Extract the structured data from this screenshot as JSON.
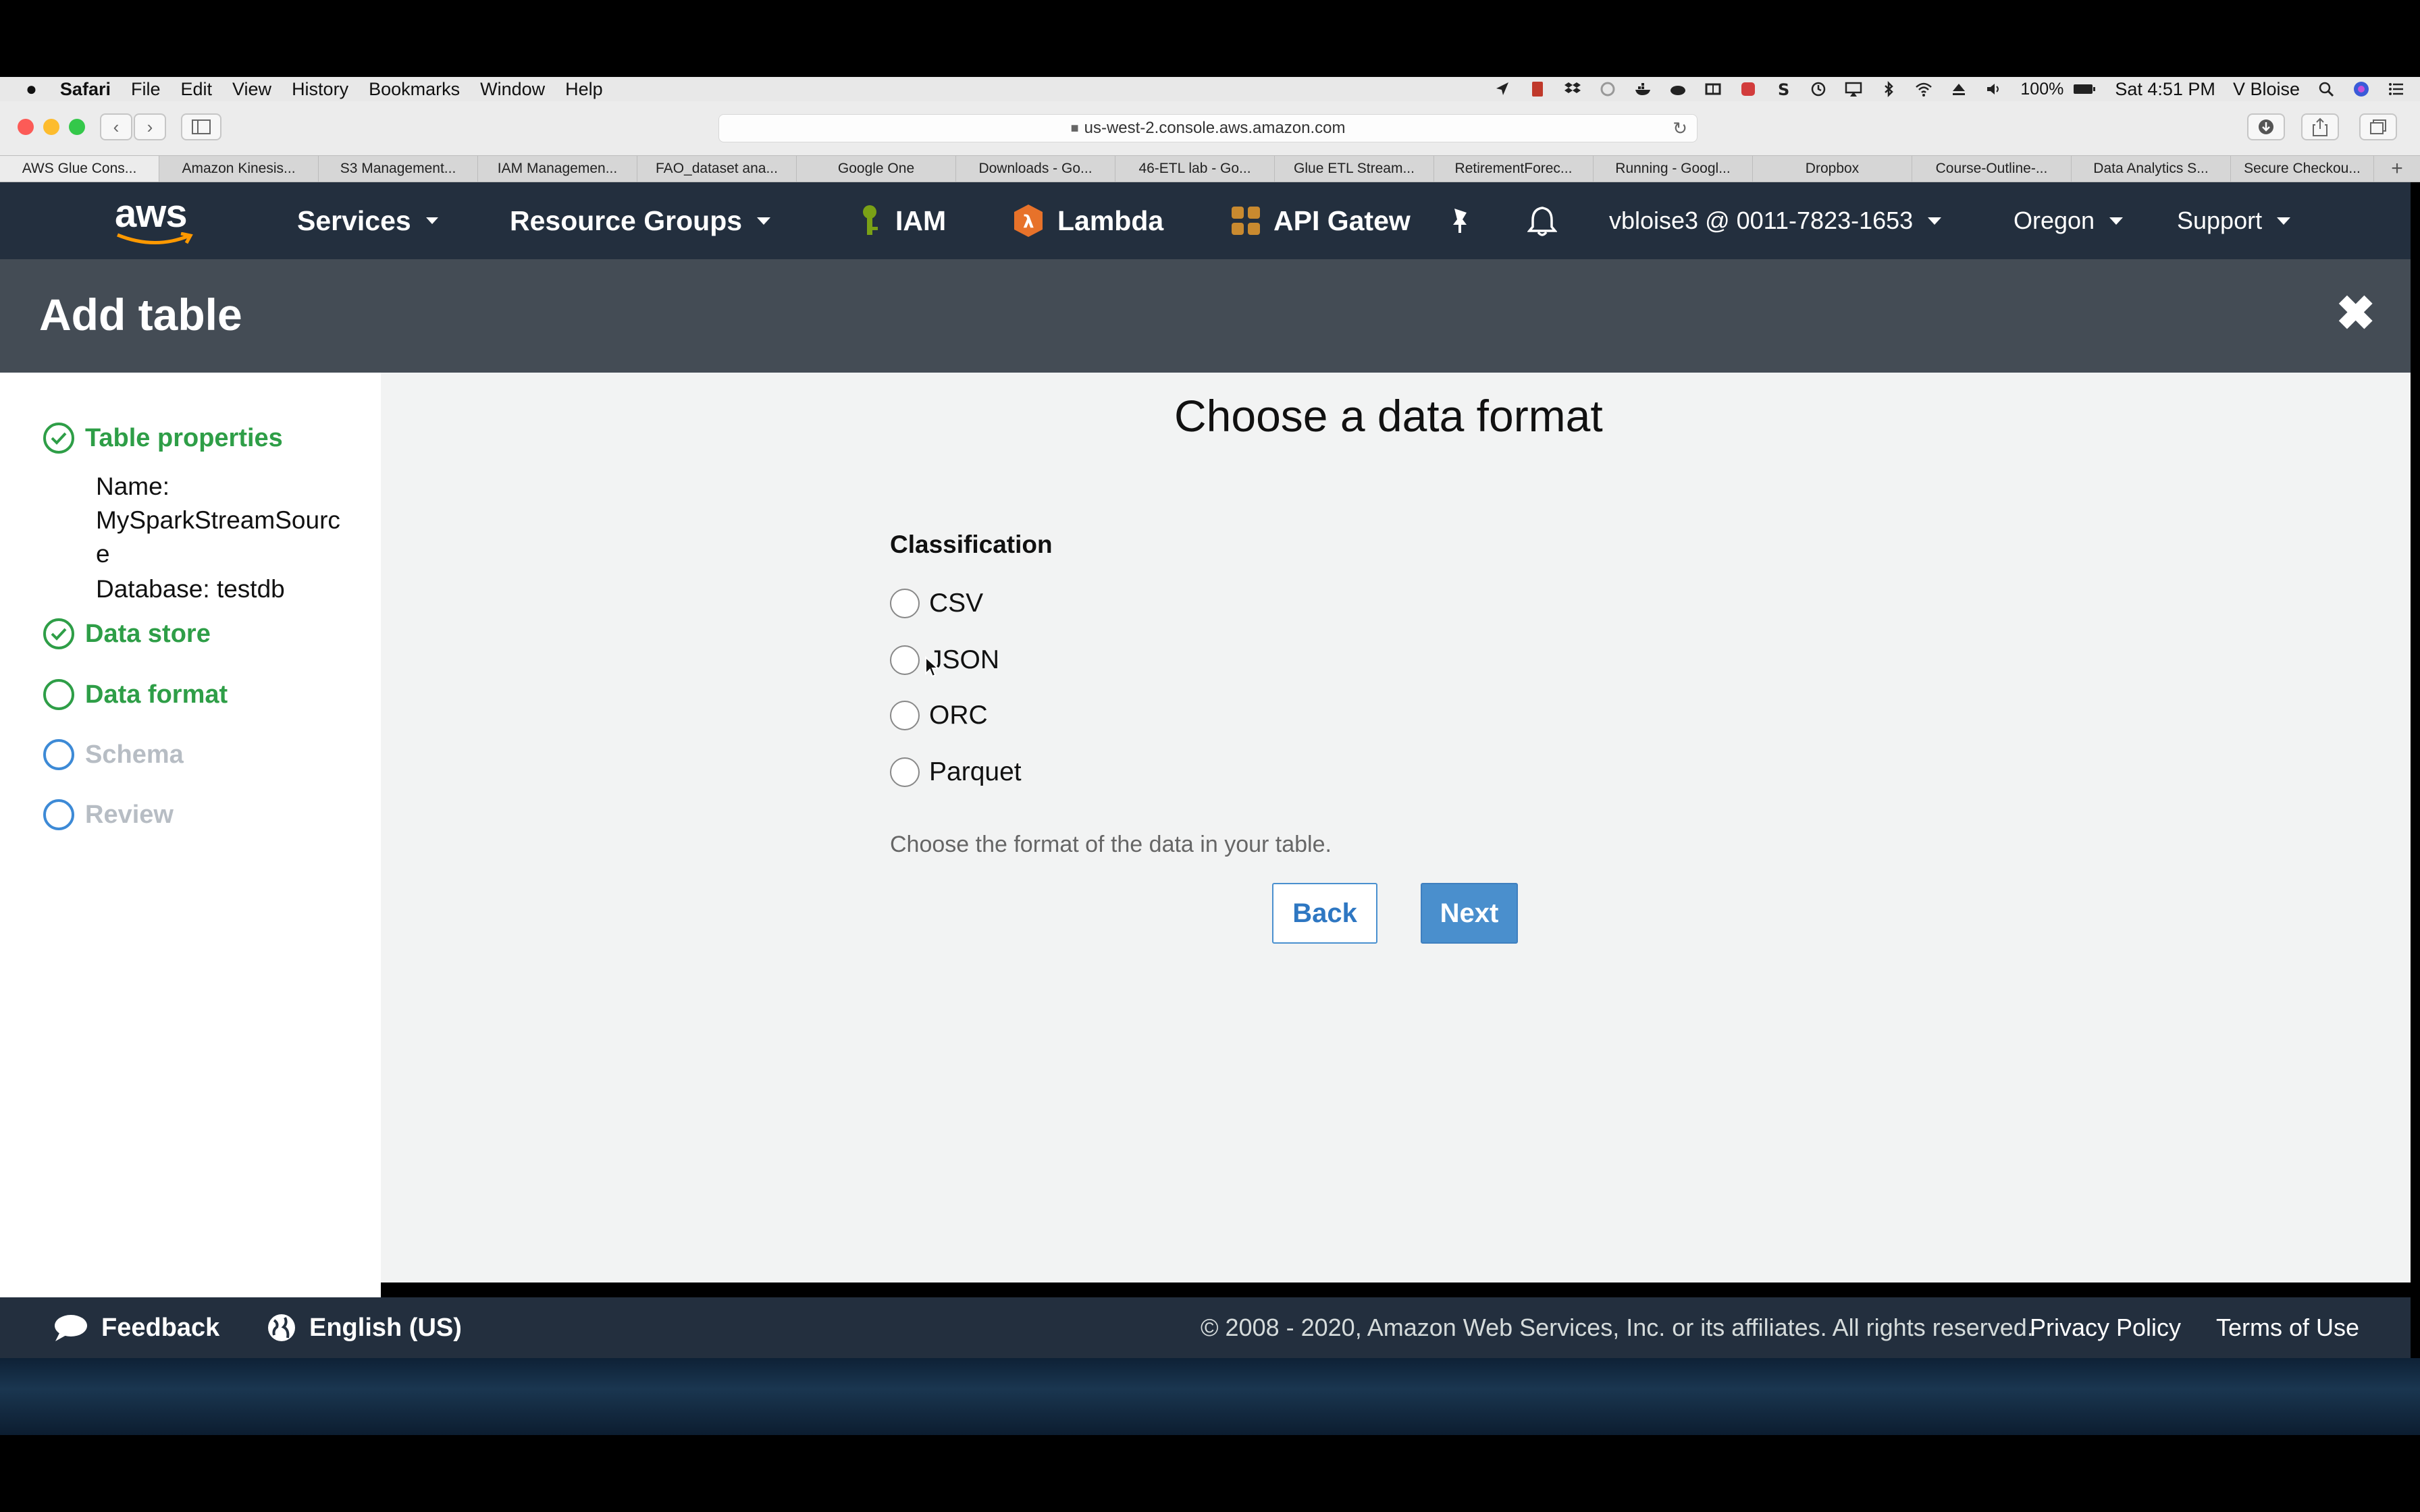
{
  "menubar": {
    "apple_icon": "apple-icon",
    "items": [
      "Safari",
      "File",
      "Edit",
      "View",
      "History",
      "Bookmarks",
      "Window",
      "Help"
    ],
    "battery": "100%",
    "clock": "Sat 4:51 PM",
    "user": "V Bloise"
  },
  "browser": {
    "url": "us-west-2.console.aws.amazon.com",
    "tabs": [
      "AWS Glue Cons...",
      "Amazon Kinesis...",
      "S3 Management...",
      "IAM Managemen...",
      "FAO_dataset ana...",
      "Google One",
      "Downloads - Go...",
      "46-ETL lab - Go...",
      "Glue ETL Stream...",
      "RetirementForec...",
      "Running - Googl...",
      "Dropbox",
      "Course-Outline-...",
      "Data Analytics S...",
      "Secure Checkou..."
    ]
  },
  "awsnav": {
    "logo": "aws",
    "services": "Services",
    "resource_groups": "Resource Groups",
    "iam": "IAM",
    "lambda": "Lambda",
    "api_gateway": "API Gatew",
    "account": "vbloise3 @ 0011-7823-1653",
    "region": "Oregon",
    "support": "Support"
  },
  "header": {
    "title": "Add table"
  },
  "steps": {
    "table_properties": "Table properties",
    "name_label": "Name:",
    "name_value_line1": "MySparkStreamSourc",
    "name_value_line2": "e",
    "database": "Database: testdb",
    "data_store": "Data store",
    "data_format": "Data format",
    "schema": "Schema",
    "review": "Review"
  },
  "main": {
    "heading": "Choose a data format",
    "classification_label": "Classification",
    "options": [
      "CSV",
      "JSON",
      "ORC",
      "Parquet"
    ],
    "helper": "Choose the format of the data in your table.",
    "back_label": "Back",
    "next_label": "Next"
  },
  "footer": {
    "feedback": "Feedback",
    "language": "English (US)",
    "copyright": "© 2008 - 2020, Amazon Web Services, Inc. or its affiliates. All rights reserved.",
    "privacy": "Privacy Policy",
    "terms": "Terms of Use"
  },
  "colors": {
    "aws_nav_bg": "#232f3e",
    "header_bg": "#444c55",
    "step_green": "#2e9e47",
    "primary_button": "#4a8fcd",
    "aws_orange": "#ff9900"
  }
}
